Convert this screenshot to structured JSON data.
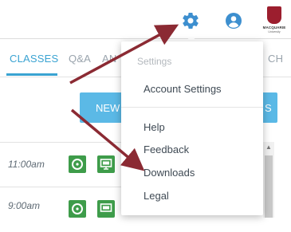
{
  "tabs": [
    "CLASSES",
    "Q&A",
    "AN",
    "CH"
  ],
  "new_button_label": "NEW",
  "new_button_suffix": "S",
  "rows": [
    {
      "time": "11:00am"
    },
    {
      "time": "9:00am"
    }
  ],
  "dropdown": {
    "heading": "Settings",
    "items": [
      "Account Settings",
      "Help",
      "Feedback",
      "Downloads",
      "Legal"
    ]
  },
  "logo": {
    "name": "MACQUARIE",
    "sub": "University"
  },
  "colors": {
    "accent": "#3aa3d2",
    "button": "#5bb9e6",
    "green": "#3e9c4a",
    "gear": "#3d8fcf",
    "arrow": "#8b2a33",
    "logo": "#9c1e2e"
  }
}
